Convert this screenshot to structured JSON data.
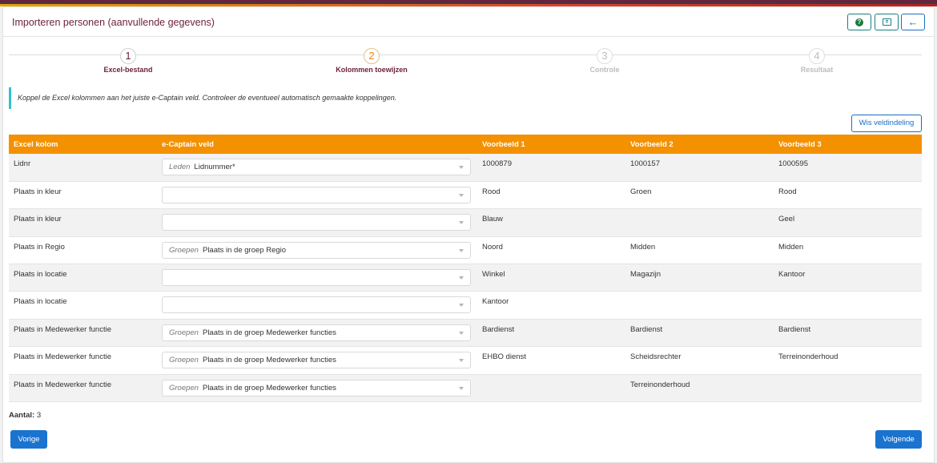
{
  "header": {
    "title": "Importeren personen (aanvullende gegevens)",
    "help_label": "?",
    "back_label": "←"
  },
  "steps": [
    {
      "number": "1",
      "label": "Excel-bestand"
    },
    {
      "number": "2",
      "label": "Kolommen toewijzen"
    },
    {
      "number": "3",
      "label": "Controle"
    },
    {
      "number": "4",
      "label": "Resultaat"
    }
  ],
  "info_text": "Koppel de Excel kolommen aan het juiste e-Captain veld. Controleer de eventueel automatisch gemaakte koppelingen.",
  "clear_button": "Wis veldindeling",
  "table": {
    "headers": [
      "Excel kolom",
      "e-Captain veld",
      "Voorbeeld 1",
      "Voorbeeld 2",
      "Voorbeeld 3"
    ],
    "rows": [
      {
        "col": "Lidnr",
        "group": "Leden",
        "field": "Lidnummer*",
        "ex1": "1000879",
        "ex2": "1000157",
        "ex3": "1000595"
      },
      {
        "col": "Plaats in kleur",
        "group": "",
        "field": "",
        "ex1": "Rood",
        "ex2": "Groen",
        "ex3": "Rood"
      },
      {
        "col": "Plaats in kleur",
        "group": "",
        "field": "",
        "ex1": "Blauw",
        "ex2": "",
        "ex3": "Geel"
      },
      {
        "col": "Plaats in Regio",
        "group": "Groepen",
        "field": "Plaats in de groep Regio",
        "ex1": "Noord",
        "ex2": "Midden",
        "ex3": "Midden"
      },
      {
        "col": "Plaats in locatie",
        "group": "",
        "field": "",
        "ex1": "Winkel",
        "ex2": "Magazijn",
        "ex3": "Kantoor"
      },
      {
        "col": "Plaats in locatie",
        "group": "",
        "field": "",
        "ex1": "Kantoor",
        "ex2": "",
        "ex3": ""
      },
      {
        "col": "Plaats in Medewerker functie",
        "group": "Groepen",
        "field": "Plaats in de groep Medewerker functies",
        "ex1": "Bardienst",
        "ex2": "Bardienst",
        "ex3": "Bardienst"
      },
      {
        "col": "Plaats in Medewerker functie",
        "group": "Groepen",
        "field": "Plaats in de groep Medewerker functies",
        "ex1": "EHBO dienst",
        "ex2": "Scheidsrechter",
        "ex3": "Terreinonderhoud"
      },
      {
        "col": "Plaats in Medewerker functie",
        "group": "Groepen",
        "field": "Plaats in de groep Medewerker functies",
        "ex1": "",
        "ex2": "Terreinonderhoud",
        "ex3": ""
      }
    ]
  },
  "footer": {
    "count_label": "Aantal:",
    "count_value": "3",
    "prev_button": "Vorige",
    "next_button": "Volgende"
  },
  "colors": {
    "brand": "#6b1f3d",
    "table_header": "#f39100",
    "primary_button": "#1a73cf",
    "info_border": "#2ec2d6"
  }
}
